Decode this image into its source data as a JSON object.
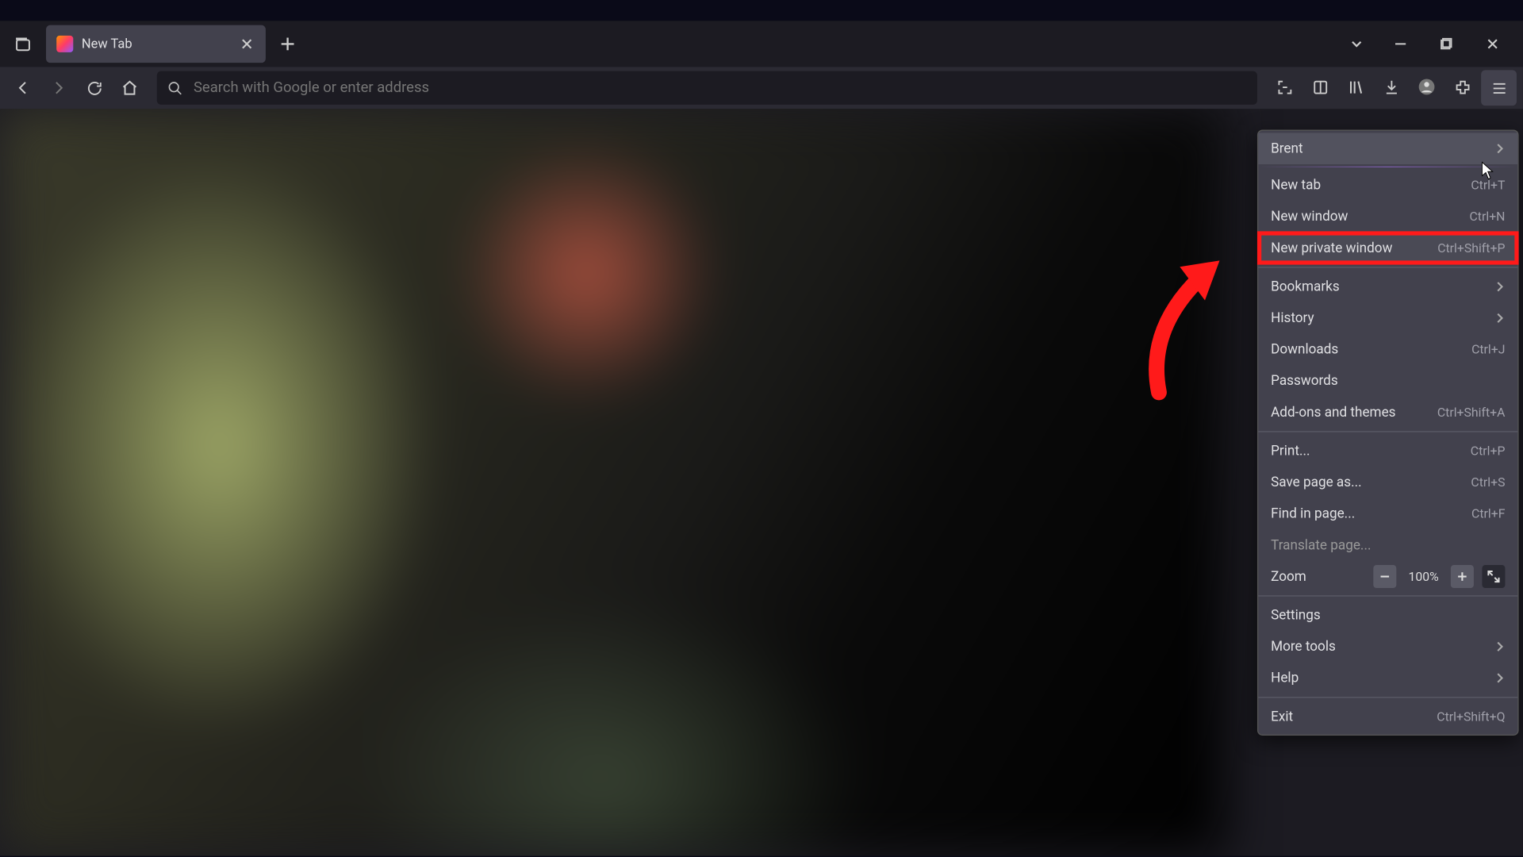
{
  "tab": {
    "title": "New Tab"
  },
  "urlbar": {
    "placeholder": "Search with Google or enter address"
  },
  "menu": {
    "account": "Brent",
    "new_tab": "New tab",
    "new_tab_sc": "Ctrl+T",
    "new_window": "New window",
    "new_window_sc": "Ctrl+N",
    "new_private": "New private window",
    "new_private_sc": "Ctrl+Shift+P",
    "bookmarks": "Bookmarks",
    "history": "History",
    "downloads": "Downloads",
    "downloads_sc": "Ctrl+J",
    "passwords": "Passwords",
    "addons": "Add-ons and themes",
    "addons_sc": "Ctrl+Shift+A",
    "print": "Print...",
    "print_sc": "Ctrl+P",
    "save": "Save page as...",
    "save_sc": "Ctrl+S",
    "find": "Find in page...",
    "find_sc": "Ctrl+F",
    "translate": "Translate page...",
    "zoom": "Zoom",
    "zoom_val": "100%",
    "settings": "Settings",
    "more_tools": "More tools",
    "help": "Help",
    "exit": "Exit",
    "exit_sc": "Ctrl+Shift+Q"
  }
}
